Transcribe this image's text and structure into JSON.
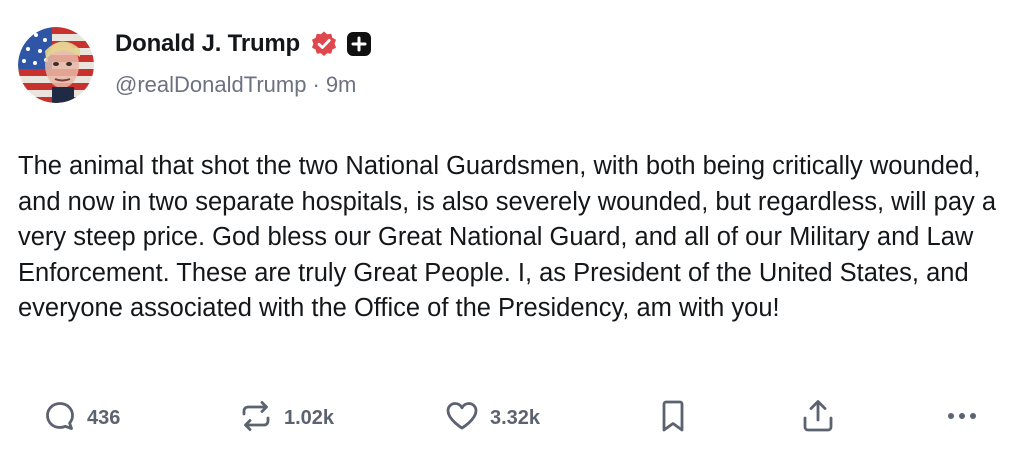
{
  "author": {
    "display_name": "Donald J. Trump",
    "handle": "@realDonaldTrump",
    "separator": "·",
    "time_ago": "9m",
    "avatar_icon": "flag-portrait-avatar",
    "verified_icon": "verified-badge-icon",
    "verified_color": "#e0474c",
    "follow_icon": "plus-square-icon"
  },
  "post": {
    "text": "The animal that shot the two National Guardsmen, with both being critically wounded, and now in two separate hospitals, is also severely wounded, but regardless, will pay a very steep price. God bless our Great National Guard, and all of our Military and Law Enforcement. These are truly Great People. I, as President of the United States, and everyone associated with the Office of the Presidency, am with you!"
  },
  "actions": {
    "reply": {
      "icon": "reply-icon",
      "count": "436"
    },
    "repost": {
      "icon": "repost-icon",
      "count": "1.02k"
    },
    "like": {
      "icon": "heart-icon",
      "count": "3.32k"
    },
    "bookmark": {
      "icon": "bookmark-icon"
    },
    "share": {
      "icon": "share-icon"
    },
    "more": {
      "icon": "more-icon"
    }
  },
  "colors": {
    "text": "#14171a",
    "muted": "#6b7280",
    "icon": "#5b6270"
  }
}
